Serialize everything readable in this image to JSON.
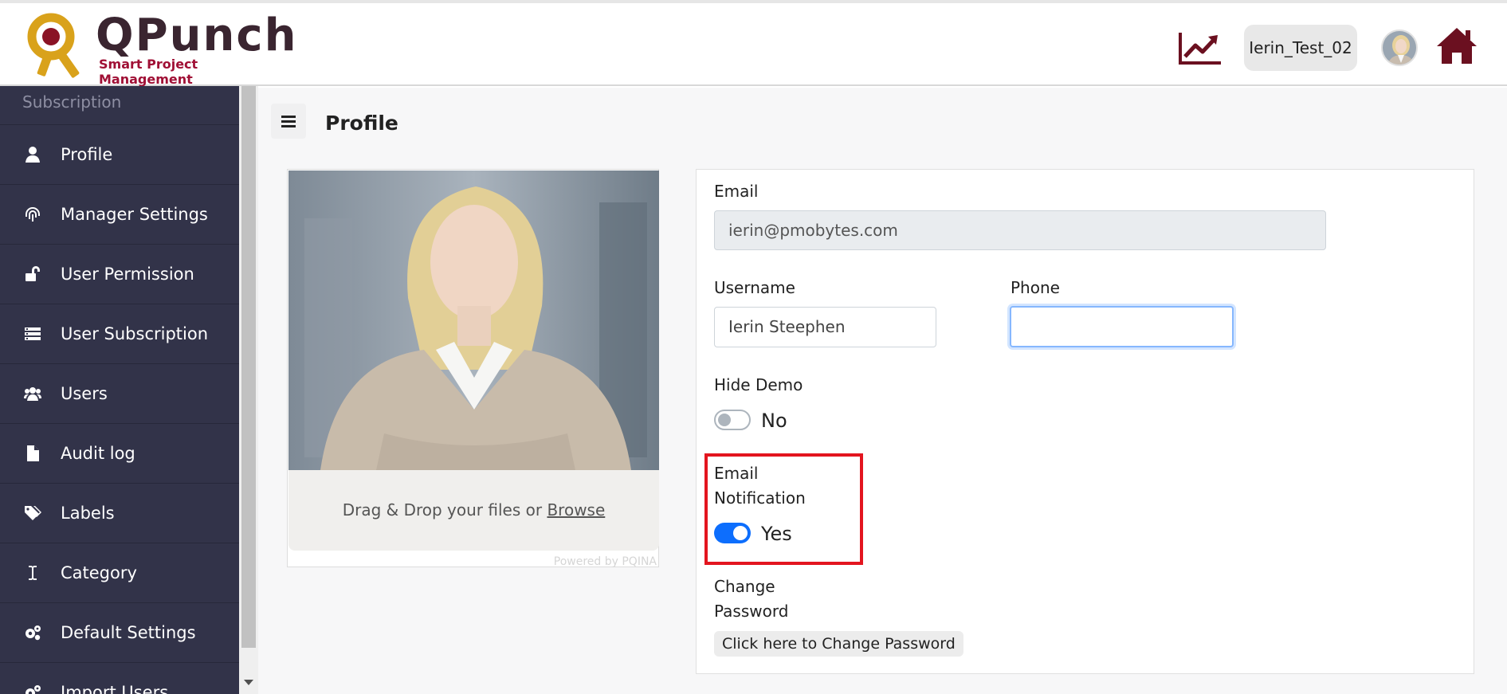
{
  "header": {
    "brand_name": "QPunch",
    "brand_tagline": "Smart Project Management",
    "username": "Ierin_Test_02",
    "icons": [
      "chart-trend-icon",
      "avatar",
      "home-icon"
    ]
  },
  "sidebar": {
    "section_label": "Subscription",
    "items": [
      {
        "label": "Profile",
        "icon": "user-icon"
      },
      {
        "label": "Manager Settings",
        "icon": "fingerprint-icon"
      },
      {
        "label": "User Permission",
        "icon": "unlock-icon"
      },
      {
        "label": "User Subscription",
        "icon": "list-icon"
      },
      {
        "label": "Users",
        "icon": "users-icon"
      },
      {
        "label": "Audit log",
        "icon": "file-icon"
      },
      {
        "label": "Labels",
        "icon": "tags-icon"
      },
      {
        "label": "Category",
        "icon": "text-cursor-icon"
      },
      {
        "label": "Default Settings",
        "icon": "gears-icon"
      },
      {
        "label": "Import Users",
        "icon": "gears-icon"
      }
    ]
  },
  "page": {
    "title": "Profile"
  },
  "uploader": {
    "drop_text": "Drag & Drop your files or ",
    "browse_text": "Browse",
    "powered_text": "Powered by PQINA"
  },
  "form": {
    "email_label": "Email",
    "email_value": "ierin@pmobytes.com",
    "username_label": "Username",
    "username_value": "Ierin Steephen",
    "phone_label": "Phone",
    "phone_value": "",
    "hide_demo_label": "Hide Demo",
    "hide_demo_value": "No",
    "email_notification_label_1": "Email",
    "email_notification_label_2": "Notification",
    "email_notification_value": "Yes",
    "change_password_label_1": "Change",
    "change_password_label_2": "Password",
    "change_password_button": "Click here to Change Password"
  },
  "colors": {
    "sidebar_bg": "#323349",
    "toggle_on": "#0d6efd",
    "highlight": "#e3151f",
    "brand_dark": "#6b1020"
  }
}
